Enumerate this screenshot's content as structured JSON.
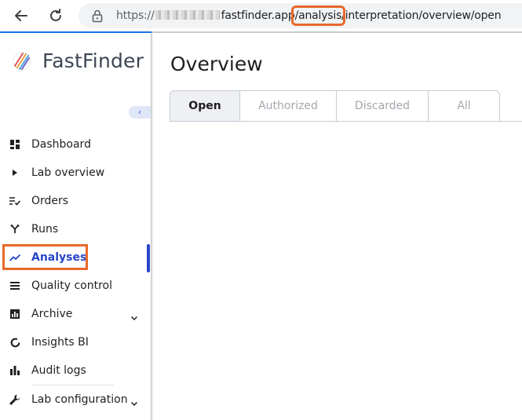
{
  "browser": {
    "url_scheme": "https://",
    "url_host": "fastfinder.app",
    "url_highlighted": "/analysis",
    "url_rest": "/interpretation/overview/open",
    "accent": "#1a73e8",
    "highlight_color": "#e8692a"
  },
  "sidebar": {
    "brand": "FastFinder",
    "collapse_glyph": "‹",
    "items": [
      {
        "label": "Dashboard",
        "icon": "dashboard-icon"
      },
      {
        "label": "Lab overview",
        "icon": "play-icon"
      },
      {
        "label": "Orders",
        "icon": "list-check-icon"
      },
      {
        "label": "Runs",
        "icon": "fork-icon"
      },
      {
        "label": "Analyses",
        "icon": "trend-icon",
        "active": true
      },
      {
        "label": "Quality control",
        "icon": "lines-icon"
      },
      {
        "label": "Archive",
        "icon": "bar-chart-icon",
        "expandable": true
      },
      {
        "label": "Insights BI",
        "icon": "donut-icon"
      },
      {
        "label": "Audit logs",
        "icon": "bar-chart-icon"
      },
      {
        "label": "Lab configuration",
        "icon": "wrench-icon",
        "expandable": true
      }
    ],
    "active_color": "#2746c9"
  },
  "main": {
    "title": "Overview",
    "tabs": [
      {
        "label": "Open",
        "selected": true
      },
      {
        "label": "Authorized"
      },
      {
        "label": "Discarded"
      },
      {
        "label": "All"
      }
    ]
  }
}
